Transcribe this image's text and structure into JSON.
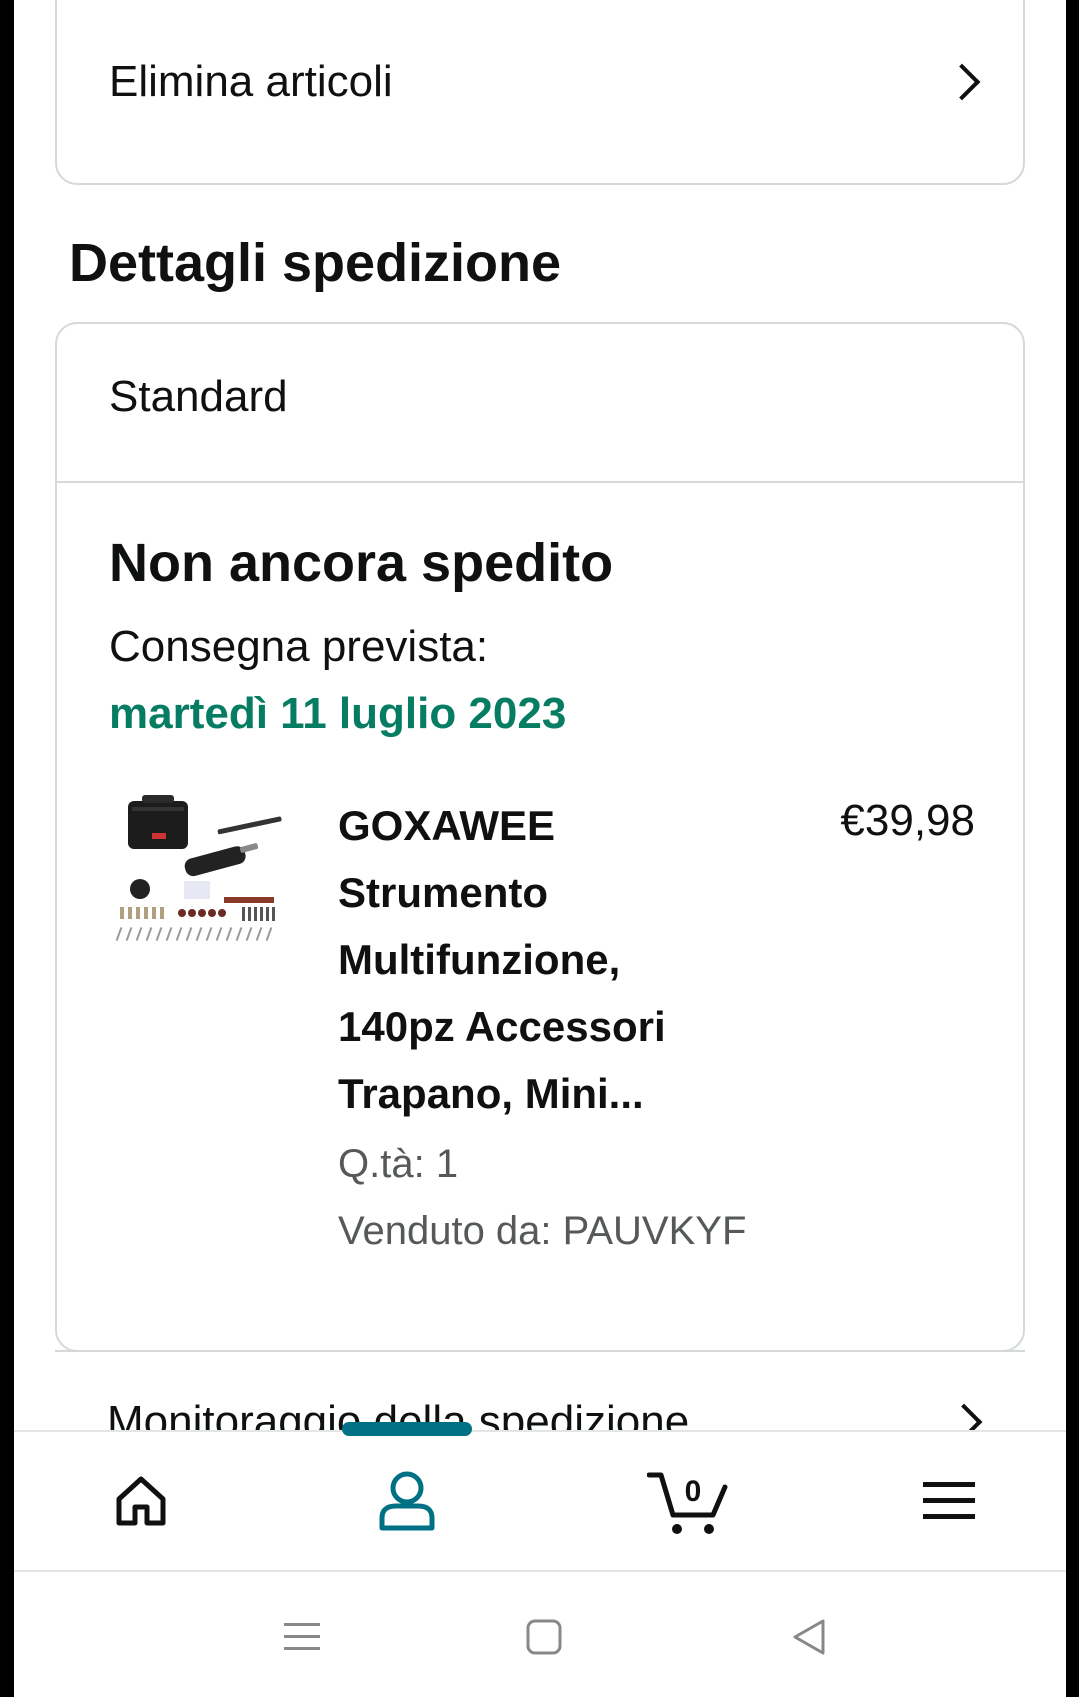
{
  "manage_items": {
    "delete_label": "Elimina articoli"
  },
  "shipment": {
    "section_title": "Dettagli spedizione",
    "type": "Standard",
    "status": "Non ancora spedito",
    "delivery_label": "Consegna prevista:",
    "delivery_date": "martedì 11 luglio 2023",
    "date_color": "#067d62",
    "product": {
      "title_lines": [
        "GOXAWEE",
        "Strumento",
        "Multifunzione,",
        "140pz Accessori",
        "Trapano, Mini..."
      ],
      "price": "€39,98",
      "quantity": "Q.tà: 1",
      "seller": "Venduto da: PAUVKYF"
    },
    "tracking_label": "Monitoraggio della spedizione"
  },
  "bottom_nav": {
    "items": [
      {
        "icon": "home-icon"
      },
      {
        "icon": "account-icon",
        "active": true
      },
      {
        "icon": "cart-icon",
        "count": "0"
      },
      {
        "icon": "menu-icon"
      }
    ],
    "accent": "#007185"
  },
  "system_nav": {
    "items": [
      "recents-icon",
      "home-square-icon",
      "back-triangle-icon"
    ]
  }
}
